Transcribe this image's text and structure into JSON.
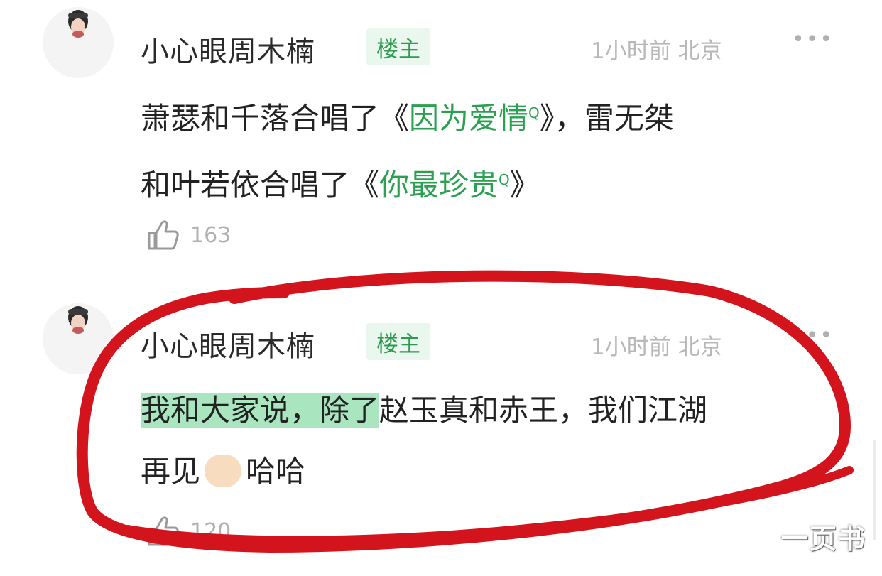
{
  "comments": [
    {
      "username": "小心眼周木楠",
      "badge": "楼主",
      "meta": "1小时前 北京",
      "more": "•••",
      "line1_prefix": "萧瑟和千落合唱了《",
      "line1_song": "因为爱情",
      "line1_suffix": "》，雷无桀",
      "line2_prefix": "和叶若依合唱了《",
      "line2_song": "你最珍贵",
      "line2_suffix": "》",
      "search_glyph": "Q",
      "likes": "163"
    },
    {
      "username": "小心眼周木楠",
      "badge": "楼主",
      "meta": "1小时前 北京",
      "more": "•••",
      "line1_highlight": "我和大家说，除了",
      "line1_rest": "赵玉真和赤王，我们江湖",
      "line2_prefix": "再见",
      "line2_suffix": "哈哈",
      "likes": "120"
    }
  ],
  "watermark": "一页书",
  "colors": {
    "badge_text": "#2e9a50",
    "badge_bg": "#eaf7ee",
    "song_link": "#2aa050",
    "highlight": "#a9e6c0",
    "annotation_ring": "#d4141c"
  },
  "icons": [
    "avatar-icon",
    "more-icon",
    "search-icon",
    "clap-emoji-icon",
    "thumbs-up-icon"
  ]
}
